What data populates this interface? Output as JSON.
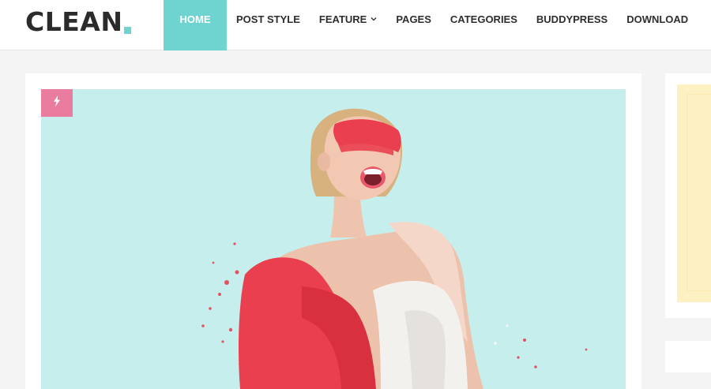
{
  "site": {
    "logo_text": "CLEAN",
    "accent_color": "#6fd3cf"
  },
  "nav": {
    "items": [
      {
        "label": "HOME",
        "active": true
      },
      {
        "label": "POST STYLE"
      },
      {
        "label": "FEATURE",
        "has_dropdown": true,
        "icon": "chevron-down-icon"
      },
      {
        "label": "PAGES"
      },
      {
        "label": "CATEGORIES"
      },
      {
        "label": "BUDDYPRESS"
      },
      {
        "label": "DOWNLOAD"
      }
    ]
  },
  "post": {
    "format_icon": "lightning-bolt-icon",
    "format_badge_color": "#ea7ca0",
    "image_background_color": "#c6eeed"
  },
  "sidebar": {
    "ad_background_color": "#fdf0c3"
  }
}
